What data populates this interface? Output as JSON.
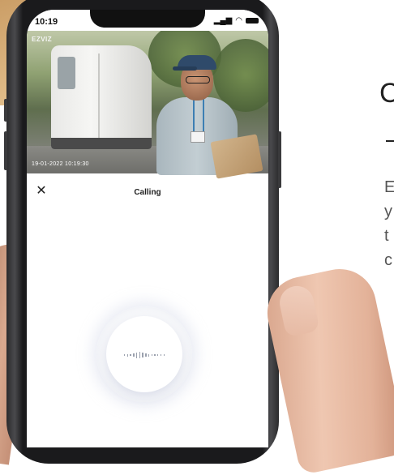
{
  "status_bar": {
    "time": "10:19",
    "signal_icon": "signal-icon",
    "wifi_icon": "wifi-icon",
    "battery_icon": "battery-icon"
  },
  "camera_feed": {
    "brand_logo": "EZVIZ",
    "timestamp": "19-01-2022 10:19:30"
  },
  "call_panel": {
    "title": "Calling",
    "close_icon": "close-icon",
    "waveform_icon": "audio-wave-icon"
  },
  "side_text": {
    "heading_fragment": "C",
    "lines": [
      "E",
      "y",
      "t",
      "c"
    ]
  },
  "colors": {
    "accent_lanyard": "#3d7fb3",
    "panel_bg": "#ffffff",
    "text": "#222222"
  }
}
